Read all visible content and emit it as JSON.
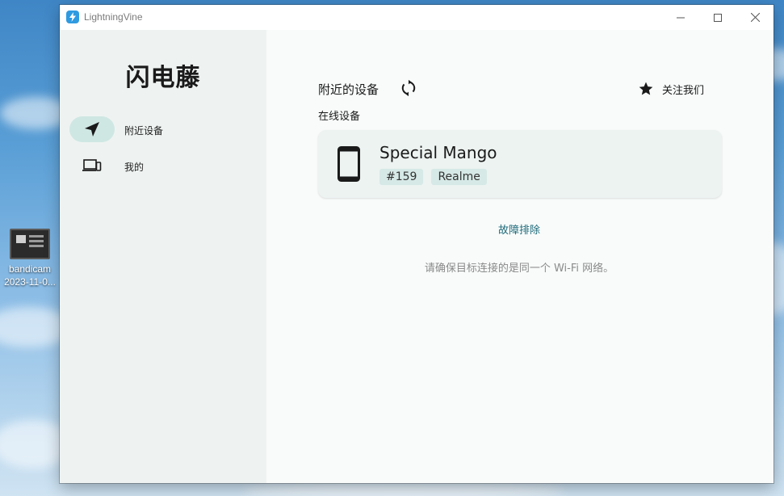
{
  "desktop": {
    "icon": {
      "name": "bandicam",
      "date": "2023-11-0..."
    }
  },
  "window": {
    "title": "LightningVine",
    "controls": {
      "minimize": "minimize-icon",
      "maximize": "maximize-icon",
      "close": "close-icon"
    }
  },
  "sidebar": {
    "brand": "闪电藤",
    "items": [
      {
        "label": "附近设备",
        "icon": "navigation-arrow-icon",
        "active": true
      },
      {
        "label": "我的",
        "icon": "devices-icon",
        "active": false
      }
    ]
  },
  "main": {
    "section_title": "附近的设备",
    "refresh_icon": "refresh-icon",
    "follow_label": "关注我们",
    "follow_icon": "star-icon",
    "subtitle": "在线设备",
    "device": {
      "name": "Special Mango",
      "tags": [
        "#159",
        "Realme"
      ],
      "icon": "smartphone-icon"
    },
    "troubleshoot": "故障排除",
    "hint": "请确保目标连接的是同一个 Wi-Fi 网络。"
  },
  "colors": {
    "sidebar_bg": "#eef3f1",
    "main_bg": "#f8fbfa",
    "active_pill": "#cfe7e3",
    "card_bg": "#ecf3f1",
    "tag_bg": "#d6e9e6",
    "link": "#1e6a7a",
    "app_icon": "#2f9ae0"
  }
}
